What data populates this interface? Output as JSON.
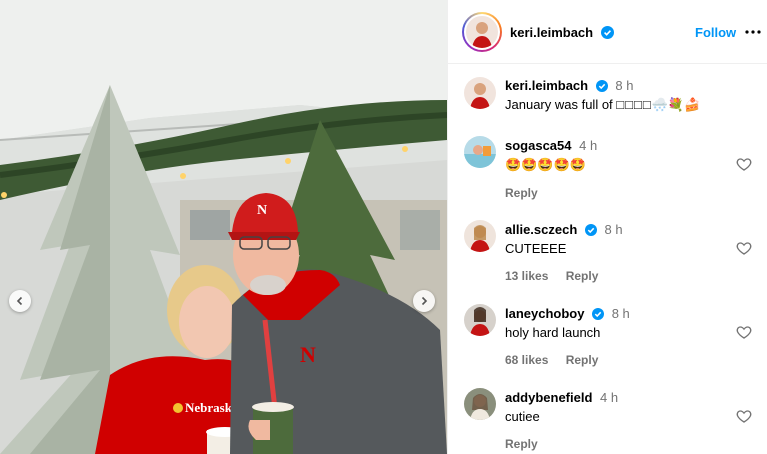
{
  "header": {
    "username": "keri.leimbach",
    "follow_label": "Follow"
  },
  "caption": {
    "username": "keri.leimbach",
    "time": "8 h",
    "text": "January was full of ",
    "emojis": [
      "🌨️",
      "💐",
      "🍰"
    ]
  },
  "comments": [
    {
      "username": "sogasca54",
      "verified": false,
      "time": "4 h",
      "text": "🤩🤩🤩🤩🤩",
      "likes": "",
      "reply": "Reply"
    },
    {
      "username": "allie.sczech",
      "verified": true,
      "time": "8 h",
      "text": "CUTEEEE",
      "likes": "13 likes",
      "reply": "Reply"
    },
    {
      "username": "laneychoboy",
      "verified": true,
      "time": "8 h",
      "text": "holy hard launch",
      "likes": "68 likes",
      "reply": "Reply"
    },
    {
      "username": "addybenefield",
      "verified": false,
      "time": "4 h",
      "text": "cutiee",
      "likes": "",
      "reply": "Reply"
    }
  ],
  "photo": {
    "sweater_text": "Nebraska",
    "cap_logo": "N",
    "jacket_logo": "N"
  },
  "colors": {
    "accent": "#0095f6",
    "verified": "#0095f6",
    "secondary_text": "#737373",
    "nebraska_red": "#d00000"
  }
}
